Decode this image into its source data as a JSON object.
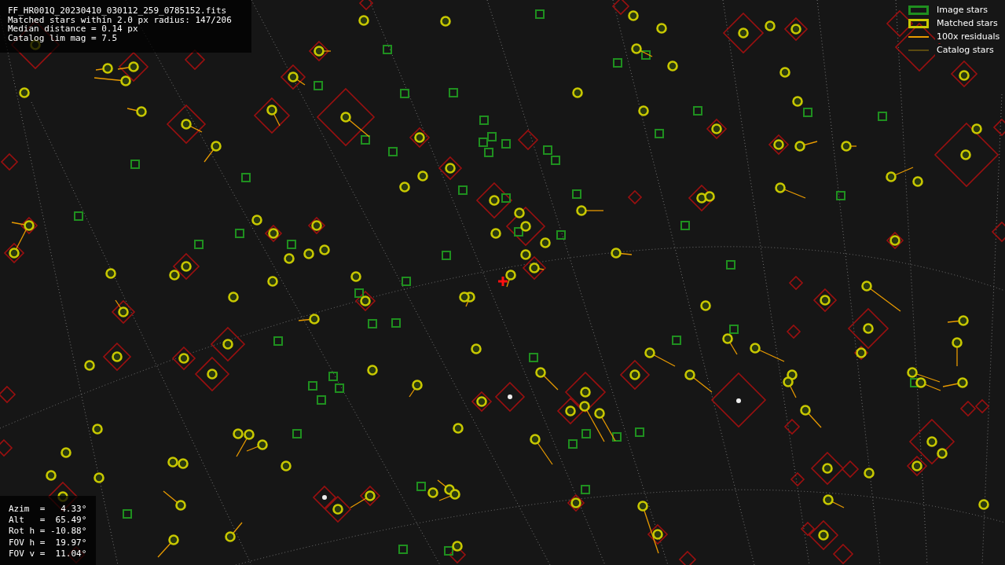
{
  "info_box": {
    "lines": [
      "FF_HR001Q_20230410_030112_259_0785152.fits",
      "Matched stars within 2.0 px radius: 147/206",
      "Median distance = 0.14 px",
      "Catalog lim mag = 7.5"
    ]
  },
  "pointing_box": {
    "lines": [
      "Azim  =   4.33°",
      "Alt   =  65.49°",
      "Rot h = -10.88°",
      "FOV h =  19.97°",
      "FOV v =  11.04°"
    ]
  },
  "legend": {
    "items": [
      {
        "label": "Image stars",
        "kind": "box",
        "color": "#1f8f1f"
      },
      {
        "label": "Matched stars",
        "kind": "box",
        "color": "#c8c800"
      },
      {
        "label": "100x residuals",
        "kind": "line",
        "color": "#e89a00"
      },
      {
        "label": "Catalog stars",
        "kind": "line",
        "color": "#5a4a10"
      }
    ]
  }
}
